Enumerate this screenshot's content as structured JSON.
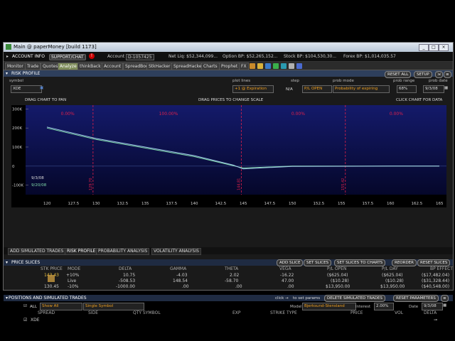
{
  "window": {
    "title": "Main @ paperMoney [build 1173]",
    "controls": [
      "_",
      "□",
      "×"
    ]
  },
  "account_bar": {
    "account_info": "ACCOUNT INFO",
    "support_chat": "SUPPORT/CHAT",
    "badge": "!",
    "account_label": "Account",
    "account_value": "D-1057425",
    "net_liq": "Net Liq: $52,344,099...",
    "option_bp": "Option BP: $52,265,152...",
    "stock_bp": "Stock BP: $104,530,30...",
    "forex_bp": "Forex BP: $1,014,035.57"
  },
  "main_tabs": [
    "Monitor",
    "Trade",
    "Quotes",
    "Analyze",
    "thinkBack",
    "Account",
    "SpreadBook",
    "StkHacker",
    "SpreadHacker",
    "Charts",
    "Prophet",
    "FX"
  ],
  "active_tab": "Analyze",
  "toolbar_icons": [
    "settings-icon",
    "lock-icon",
    "chart-icon",
    "plus-icon",
    "globe-icon",
    "message-icon",
    "help-icon"
  ],
  "risk_profile": {
    "header": "RISK PROFILE",
    "reset_all": "RESET ALL",
    "setup": "SETUP",
    "symbol_label": "symbol",
    "symbol_value": "XDE",
    "plot_lines_label": "plot lines",
    "plot_lines_value": "+1 @ Expiration",
    "step_label": "step",
    "step_value": "N/A",
    "pl_open": "P/L OPEN",
    "prob_mode_label": "prob mode",
    "prob_mode_value": "Probability of expiring",
    "prob_range_label": "prob range",
    "prob_range_value": "68%",
    "prob_date_label": "prob date",
    "prob_date_value": "9/3/08",
    "drag_pan": "DRAG CHART TO PAN",
    "drag_prices": "DRAG PRICES TO CHANGE SCALE",
    "click_data": "CLICK CHART FOR DATA"
  },
  "chart_data": {
    "type": "line",
    "x_ticks": [
      "120",
      "127.5",
      "130",
      "132.5",
      "135",
      "137.5",
      "140",
      "142.5",
      "145",
      "147.5",
      "150",
      "152.5",
      "155",
      "157.5",
      "160",
      "162.5",
      "165"
    ],
    "y_ticks": [
      "300K",
      "200K",
      "100K",
      "0",
      "-100K"
    ],
    "ylim": [
      -150000,
      320000
    ],
    "zone_pcts": [
      "0.00%",
      "100.00%",
      "0.00%",
      "0.00%"
    ],
    "vlines": [
      129.7,
      144.81,
      155.42
    ],
    "vline_labels": [
      "129.70",
      "144.81",
      "155.42"
    ],
    "date_labels": [
      "9/3/08",
      "9/20/08"
    ],
    "series": [
      {
        "color": "#7fd8a8",
        "x": [
          120,
          130,
          140,
          145,
          150,
          160,
          165
        ],
        "y": [
          200000,
          140000,
          50000,
          -10000,
          0,
          0,
          0
        ]
      },
      {
        "color": "#a0c8e8",
        "x": [
          120,
          130,
          140,
          144,
          145,
          147.5,
          150,
          160,
          165
        ],
        "y": [
          205000,
          145000,
          55000,
          5000,
          -15000,
          -8000,
          -2000,
          0,
          0
        ]
      }
    ]
  },
  "section_tabs": [
    "ADD SIMULATED TRADES",
    "RISK PROFILE",
    "PROBABILITY ANALYSIS",
    "VOLATILITY ANALYSIS"
  ],
  "price_slices": {
    "header": "PRICE SLICES",
    "buttons": [
      "ADD SLICE",
      "SET SLICES",
      "SET SLICES TO CHARTS",
      "REORDER",
      "RESET SLICES"
    ],
    "columns": [
      "STK PRICE",
      "MODE",
      "DELTA",
      "GAMMA",
      "THETA",
      "VEGA",
      "P/L OPEN",
      "P/L DAY",
      "BP EFFECT"
    ],
    "rows": [
      [
        "143.43",
        "+10%",
        "10.75",
        "-4.03",
        "2.02",
        "-16.22",
        "($625.04)",
        "($625.04)",
        "($17,482.04)"
      ],
      [
        "",
        "Live",
        "-508.53",
        "148.54",
        "-58.70",
        "47.00",
        "($10.28)",
        "($10.28)",
        "($31,328.44)"
      ],
      [
        "130.45",
        "-10%",
        "-1000.00",
        ".00",
        ".00",
        ".00",
        "$13,950.00",
        "$13,950.00",
        "($40,548.00)"
      ]
    ]
  },
  "positions": {
    "header": "POSITIONS AND SIMULATED TRADES",
    "click_hint": "click",
    "set_params": "to set params",
    "delete_btn": "DELETE SIMULATED TRADES",
    "reset_params": "RESET PARAMETERS",
    "all_label": "ALL",
    "show_all": "Show All",
    "single_symbol": "Single Symbol",
    "model_label": "Model",
    "model_value": "Bjerksund-Stensland",
    "interest_label": "Interest",
    "interest_value": "2.00%",
    "date_label": "Date",
    "date_value": "9/3/08",
    "columns": [
      "SPREAD",
      "SIDE",
      "QTY SYMBOL",
      "EXP",
      "STRIKE TYPE",
      "PRICE",
      "VOL",
      "DELTA"
    ],
    "row_symbol": "XDE"
  }
}
